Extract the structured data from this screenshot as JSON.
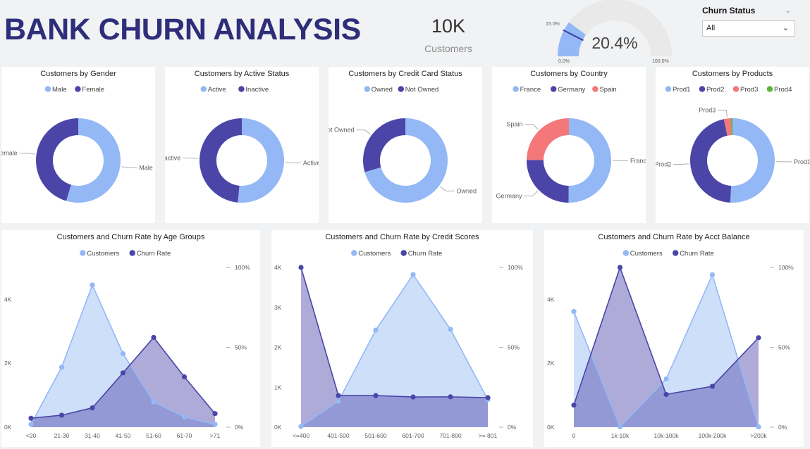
{
  "header": {
    "title": "BANK CHURN ANALYSIS",
    "kpi_value": "10K",
    "kpi_label": "Customers"
  },
  "gauge": {
    "value": 20.4,
    "value_label": "20.4%",
    "target_label": "15.0%",
    "min_label": "0.0%",
    "max_label": "100.0%",
    "fill_color": "#93b8f5",
    "track_color": "#e9e9e9",
    "target_color": "#3f3fa0"
  },
  "slicer": {
    "title": "Churn Status",
    "value": "All",
    "icon": "chevron-down-icon"
  },
  "colors": {
    "light_blue": "#93b8f5",
    "dark_blue": "#4b45a8",
    "salmon": "#f4777a",
    "green": "#5bb53d",
    "background": "#f1f2f4"
  },
  "chart_data": [
    {
      "type": "donut",
      "title": "Customers by Gender",
      "categories": [
        "Male",
        "Female"
      ],
      "values": [
        5457,
        4543
      ],
      "colors": [
        "#93b8f5",
        "#4b45a8"
      ]
    },
    {
      "type": "donut",
      "title": "Customers by Active Status",
      "categories": [
        "Active",
        "Inactive"
      ],
      "values": [
        5151,
        4849
      ],
      "colors": [
        "#93b8f5",
        "#4b45a8"
      ]
    },
    {
      "type": "donut",
      "title": "Customers by Credit Card Status",
      "categories": [
        "Owned",
        "Not Owned"
      ],
      "values": [
        7055,
        2945
      ],
      "colors": [
        "#93b8f5",
        "#4b45a8"
      ]
    },
    {
      "type": "donut",
      "title": "Customers by Country",
      "categories": [
        "France",
        "Germany",
        "Spain"
      ],
      "values": [
        5014,
        2509,
        2477
      ],
      "colors": [
        "#93b8f5",
        "#4b45a8",
        "#f4777a"
      ]
    },
    {
      "type": "donut",
      "title": "Customers by Products",
      "categories": [
        "Prod1",
        "Prod2",
        "Prod3",
        "Prod4"
      ],
      "values": [
        5084,
        4590,
        266,
        60
      ],
      "colors": [
        "#93b8f5",
        "#4b45a8",
        "#f4777a",
        "#5bb53d"
      ],
      "visible_labels": [
        "Prod1",
        "Prod2",
        "Prod3"
      ]
    },
    {
      "type": "area",
      "title": "Customers and Churn Rate by Age Groups",
      "categories": [
        "<20",
        "21-30",
        "31-40",
        "41-50",
        "51-60",
        "61-70",
        ">71"
      ],
      "series": [
        {
          "name": "Customers",
          "axis": "left",
          "values": [
            90,
            1880,
            4450,
            2300,
            790,
            320,
            90
          ]
        },
        {
          "name": "Churn Rate",
          "axis": "right",
          "values": [
            5.6,
            7.5,
            12.1,
            34.0,
            56.2,
            31.5,
            8.5
          ]
        }
      ],
      "ylim_left": [
        0,
        5000
      ],
      "yticks_left": [
        "0K",
        "2K",
        "4K"
      ],
      "ylim_right": [
        0,
        100
      ],
      "yticks_right": [
        "0%",
        "50%",
        "100%"
      ],
      "legend": "top-center"
    },
    {
      "type": "area",
      "title": "Customers and Churn Rate by Credit Scores",
      "categories": [
        "<=400",
        "401-500",
        "501-600",
        "601-700",
        "701-800",
        ">= 801"
      ],
      "series": [
        {
          "name": "Customers",
          "axis": "left",
          "values": [
            20,
            650,
            2430,
            3820,
            2450,
            690
          ]
        },
        {
          "name": "Churn Rate",
          "axis": "right",
          "values": [
            100,
            19.8,
            19.8,
            18.9,
            19.0,
            18.5
          ]
        }
      ],
      "ylim_left": [
        0,
        4000
      ],
      "yticks_left": [
        "0K",
        "1K",
        "2K",
        "3K",
        "4K"
      ],
      "ylim_right": [
        0,
        100
      ],
      "yticks_right": [
        "0%",
        "50%",
        "100%"
      ],
      "legend": "top-center"
    },
    {
      "type": "area",
      "title": "Customers and Churn Rate by Acct Balance",
      "categories": [
        "0",
        "1k-10k",
        "10k-100k",
        "100k-200k",
        ">200k"
      ],
      "series": [
        {
          "name": "Customers",
          "axis": "left",
          "values": [
            3620,
            10,
            1510,
            4770,
            10
          ]
        },
        {
          "name": "Churn Rate",
          "axis": "right",
          "values": [
            13.8,
            100,
            20.5,
            25.6,
            56.0
          ]
        }
      ],
      "ylim_left": [
        0,
        5000
      ],
      "yticks_left": [
        "0K",
        "2K",
        "4K"
      ],
      "ylim_right": [
        0,
        100
      ],
      "yticks_right": [
        "0%",
        "50%",
        "100%"
      ],
      "legend": "top-center"
    }
  ]
}
